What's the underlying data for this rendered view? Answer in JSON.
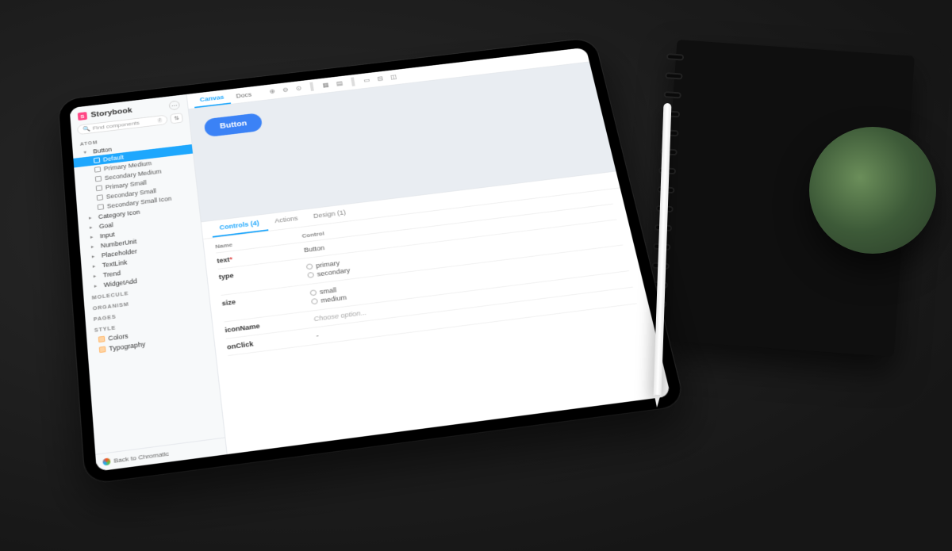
{
  "app": {
    "title": "Storybook"
  },
  "search": {
    "placeholder": "Find components",
    "shortcut": "/"
  },
  "sidebar": {
    "sections": {
      "atom": "ATOM",
      "molecule": "MOLECULE",
      "organism": "ORGANISM",
      "pages": "PAGES",
      "style": "STYLE"
    },
    "atom_items": [
      "Button",
      "Default",
      "Primary Medium",
      "Secondary Medium",
      "Primary Small",
      "Secondary Small",
      "Secondary Small Icon",
      "Category Icon",
      "Goal",
      "Input",
      "NumberUnit",
      "Placeholder",
      "TextLink",
      "Trend",
      "WidgetAdd"
    ],
    "style_items": [
      "Colors",
      "Typography"
    ]
  },
  "footer": {
    "back": "Back to Chromatic"
  },
  "tabs": {
    "canvas": "Canvas",
    "docs": "Docs"
  },
  "preview": {
    "button_label": "Button"
  },
  "addons": {
    "tabs": {
      "controls": "Controls (4)",
      "actions": "Actions",
      "design": "Design (1)"
    },
    "headers": {
      "name": "Name",
      "control": "Control"
    },
    "rows": {
      "text": {
        "name": "text",
        "required": "*",
        "value": "Button"
      },
      "type": {
        "name": "type",
        "options": [
          "primary",
          "secondary"
        ]
      },
      "size": {
        "name": "size",
        "options": [
          "small",
          "medium"
        ]
      },
      "iconName": {
        "name": "iconName",
        "value": "Choose option..."
      },
      "onClick": {
        "name": "onClick",
        "value": "-"
      }
    }
  }
}
